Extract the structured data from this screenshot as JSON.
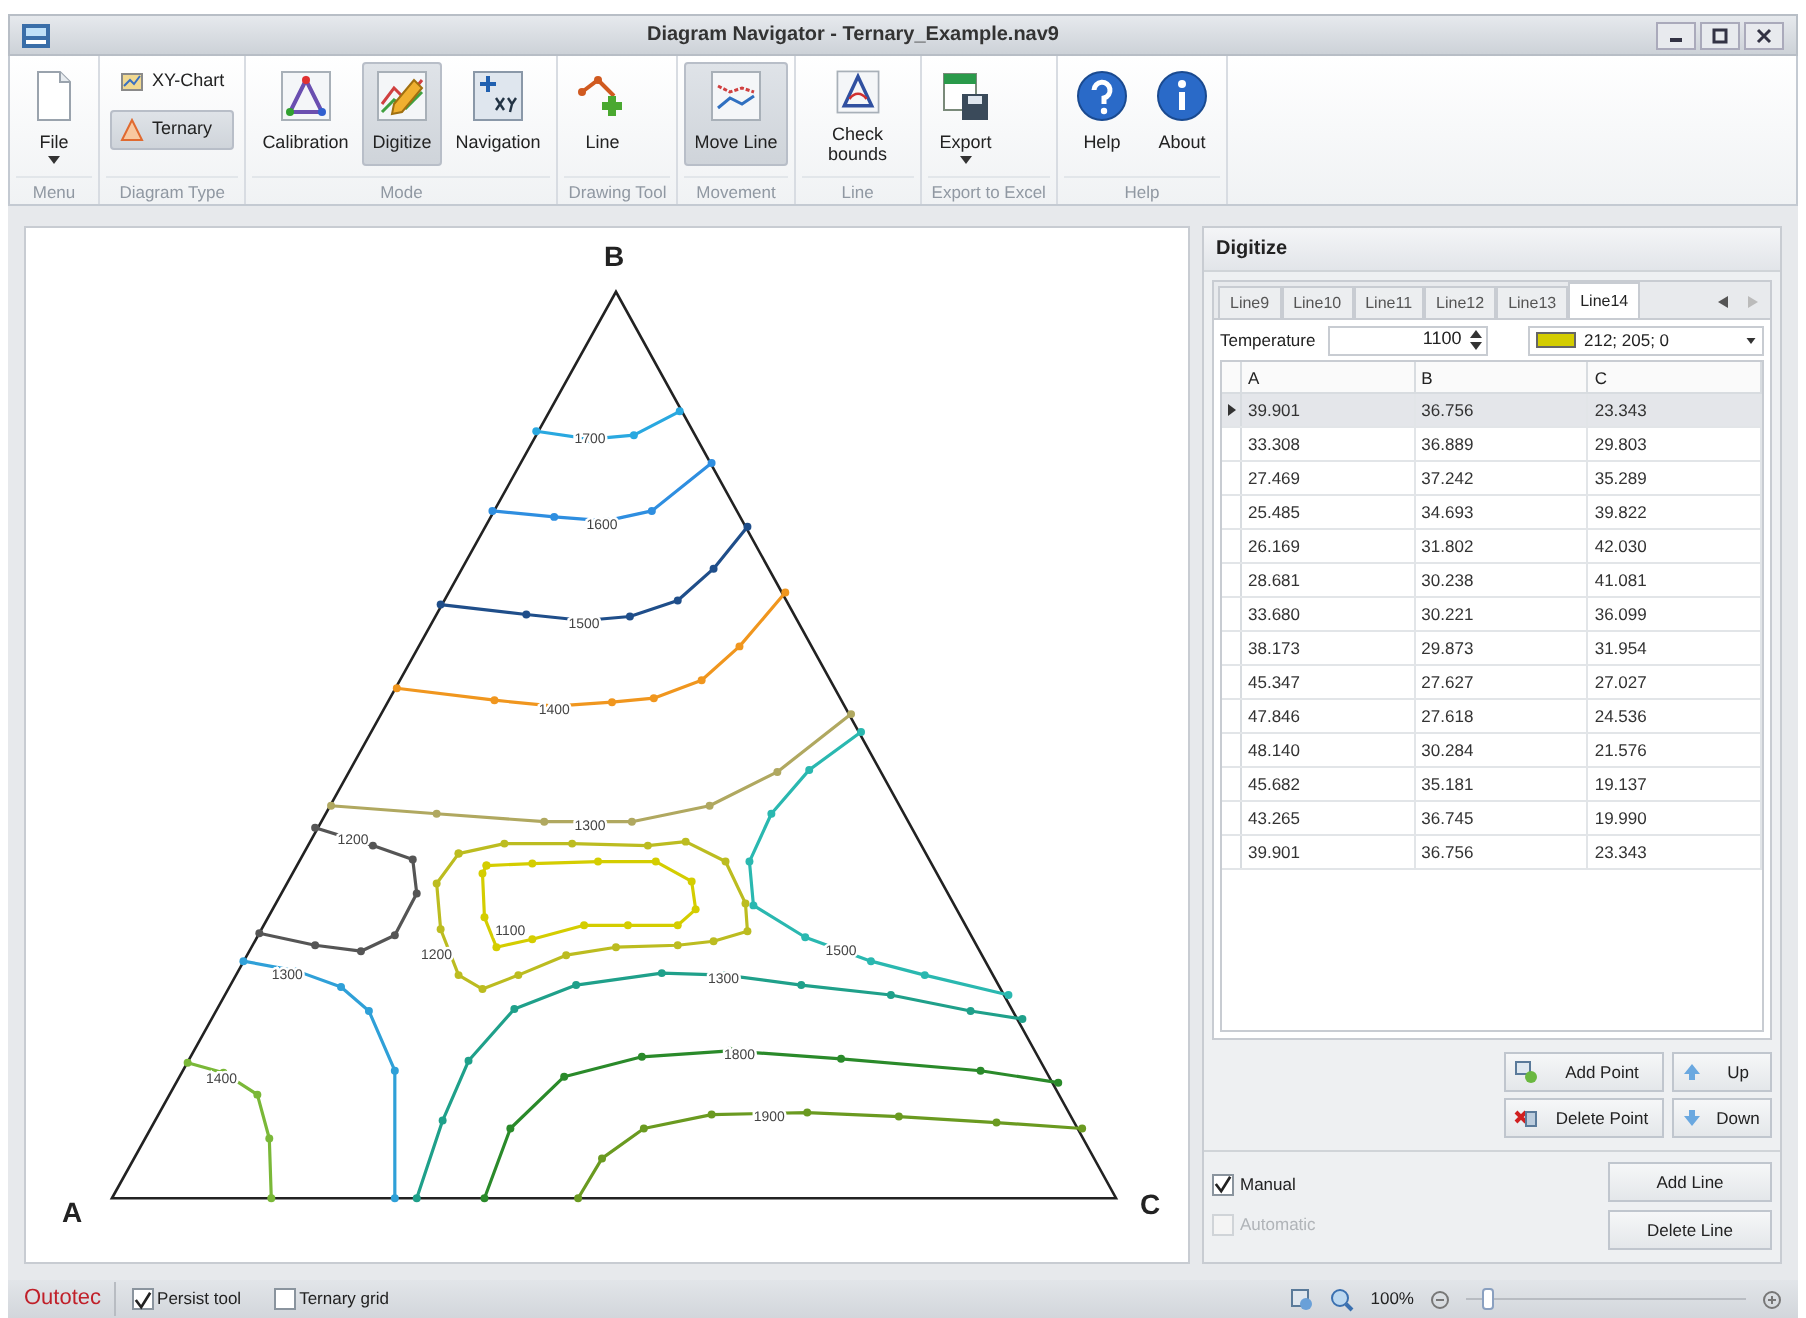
{
  "window": {
    "title": "Diagram Navigator - Ternary_Example.nav9"
  },
  "ribbon": {
    "groups": [
      {
        "label": "Menu",
        "items": [
          {
            "kind": "large",
            "label": "File",
            "dropdown": true,
            "selected": false
          }
        ]
      },
      {
        "label": "Diagram Type",
        "items": [
          {
            "kind": "small",
            "label": "XY-Chart",
            "selected": false
          },
          {
            "kind": "small",
            "label": "Ternary",
            "selected": true
          }
        ]
      },
      {
        "label": "Mode",
        "items": [
          {
            "kind": "large",
            "label": "Calibration",
            "selected": false
          },
          {
            "kind": "large",
            "label": "Digitize",
            "selected": true
          },
          {
            "kind": "large",
            "label": "Navigation",
            "selected": false
          }
        ]
      },
      {
        "label": "Drawing Tool",
        "items": [
          {
            "kind": "large",
            "label": "Line",
            "selected": false
          }
        ]
      },
      {
        "label": "Movement",
        "items": [
          {
            "kind": "large",
            "label": "Move Line",
            "selected": true
          }
        ]
      },
      {
        "label": "Line",
        "items": [
          {
            "kind": "large",
            "label": "Check bounds",
            "selected": false
          }
        ]
      },
      {
        "label": "Export to Excel",
        "items": [
          {
            "kind": "large",
            "label": "Export",
            "dropdown": true,
            "selected": false
          }
        ]
      },
      {
        "label": "Help",
        "items": [
          {
            "kind": "large",
            "label": "Help",
            "selected": false
          },
          {
            "kind": "large",
            "label": "About",
            "selected": false
          }
        ]
      }
    ]
  },
  "diagram": {
    "vertices": [
      "A",
      "B",
      "C"
    ],
    "contours": [
      {
        "label": "1700",
        "color": "#29a8e0"
      },
      {
        "label": "1600",
        "color": "#2e8ee0"
      },
      {
        "label": "1500",
        "color": "#1f4e8a"
      },
      {
        "label": "1400",
        "color": "#f0961e"
      },
      {
        "label": "1300",
        "color": "#b0a860"
      },
      {
        "label": "1200",
        "color": "#555555"
      },
      {
        "label": "1100",
        "color": "#d4cd00"
      },
      {
        "label": "1200",
        "color": "#bcbc20"
      },
      {
        "label": "1300",
        "color": "#2fa0d8"
      },
      {
        "label": "1400",
        "color": "#7ab838"
      },
      {
        "label": "1500",
        "color": "#2ab8b0"
      },
      {
        "label": "1300",
        "color": "#1fa08a"
      },
      {
        "label": "1800",
        "color": "#2a8a2a"
      },
      {
        "label": "1900",
        "color": "#6a9a20"
      }
    ]
  },
  "panel": {
    "title": "Digitize",
    "tabs": [
      {
        "label": "Line9",
        "selected": false
      },
      {
        "label": "Line10",
        "selected": false
      },
      {
        "label": "Line11",
        "selected": false
      },
      {
        "label": "Line12",
        "selected": false
      },
      {
        "label": "Line13",
        "selected": false
      },
      {
        "label": "Line14",
        "selected": true
      }
    ],
    "temperature": {
      "label": "Temperature",
      "value": "1100"
    },
    "line_color": {
      "color": "#d4cd00",
      "value": "212; 205; 0"
    },
    "table": {
      "columns": [
        "A",
        "B",
        "C"
      ],
      "rows": [
        {
          "cells": [
            "39.901",
            "36.756",
            "23.343"
          ],
          "selected": true
        },
        {
          "cells": [
            "33.308",
            "36.889",
            "29.803"
          ],
          "selected": false
        },
        {
          "cells": [
            "27.469",
            "37.242",
            "35.289"
          ],
          "selected": false
        },
        {
          "cells": [
            "25.485",
            "34.693",
            "39.822"
          ],
          "selected": false
        },
        {
          "cells": [
            "26.169",
            "31.802",
            "42.030"
          ],
          "selected": false
        },
        {
          "cells": [
            "28.681",
            "30.238",
            "41.081"
          ],
          "selected": false
        },
        {
          "cells": [
            "33.680",
            "30.221",
            "36.099"
          ],
          "selected": false
        },
        {
          "cells": [
            "38.173",
            "29.873",
            "31.954"
          ],
          "selected": false
        },
        {
          "cells": [
            "45.347",
            "27.627",
            "27.027"
          ],
          "selected": false
        },
        {
          "cells": [
            "47.846",
            "27.618",
            "24.536"
          ],
          "selected": false
        },
        {
          "cells": [
            "48.140",
            "30.284",
            "21.576"
          ],
          "selected": false
        },
        {
          "cells": [
            "45.682",
            "35.181",
            "19.137"
          ],
          "selected": false
        },
        {
          "cells": [
            "43.265",
            "36.745",
            "19.990"
          ],
          "selected": false
        },
        {
          "cells": [
            "39.901",
            "36.756",
            "23.343"
          ],
          "selected": false
        }
      ]
    },
    "point_buttons": [
      "Add Point",
      "Up",
      "Delete Point",
      "Down"
    ],
    "modes": [
      {
        "label": "Manual",
        "checked": true,
        "disabled": false
      },
      {
        "label": "Automatic",
        "checked": false,
        "disabled": true
      }
    ],
    "line_buttons": [
      "Add Line",
      "Delete Line"
    ]
  },
  "status_bar": {
    "logo": "Outotec",
    "toggles": [
      {
        "label": "Persist tool",
        "checked": true
      },
      {
        "label": "Ternary grid",
        "checked": false
      }
    ],
    "zoom": {
      "value": "100%",
      "level": 0.08
    }
  }
}
